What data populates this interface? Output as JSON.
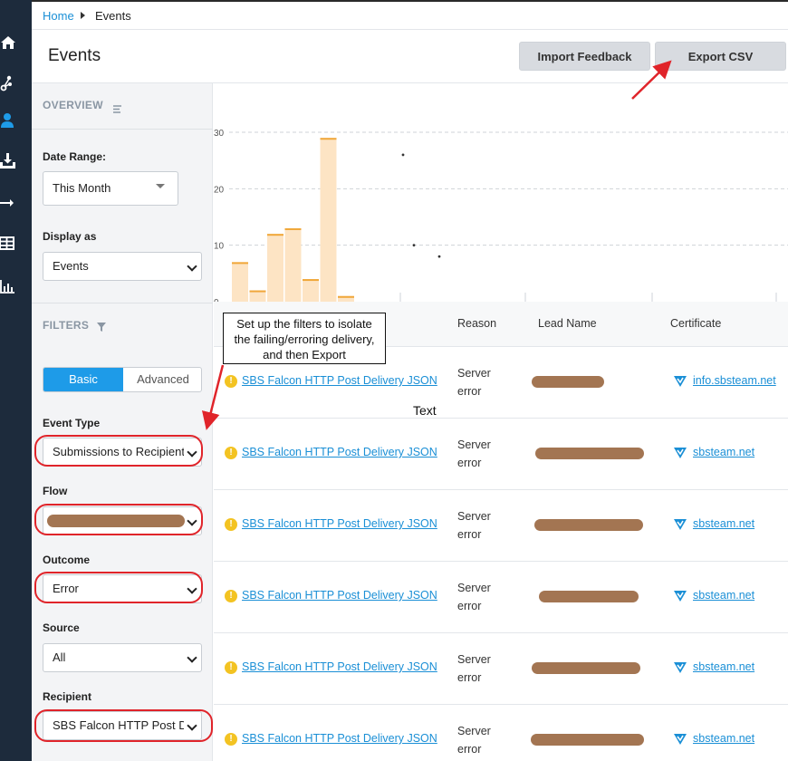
{
  "breadcrumb": {
    "home": "Home",
    "current": "Events"
  },
  "header": {
    "title": "Events",
    "import_label": "Import Feedback",
    "export_label": "Export CSV"
  },
  "nav_icons": [
    "home-icon",
    "flow-icon",
    "user-icon",
    "download-icon",
    "arrow-right-icon",
    "table-icon",
    "bar-chart-icon"
  ],
  "sidebar": {
    "overview_title": "OVERVIEW",
    "date_range_label": "Date Range:",
    "date_range_value": "This Month",
    "display_as_label": "Display as",
    "display_as_value": "Events",
    "filters_title": "FILTERS",
    "tab_basic": "Basic",
    "tab_advanced": "Advanced",
    "event_type_label": "Event Type",
    "event_type_value": "Submissions to Recipient",
    "flow_label": "Flow",
    "outcome_label": "Outcome",
    "outcome_value": "Error",
    "source_label": "Source",
    "source_value": "All",
    "recipient_label": "Recipient",
    "recipient_value": "SBS Falcon HTTP Post Delivery JSON"
  },
  "chart_data": {
    "type": "bar",
    "ylim": [
      0,
      30
    ],
    "yticks": [
      "0",
      "10",
      "20",
      "30"
    ],
    "values": [
      7,
      2,
      12,
      13,
      4,
      29,
      1
    ],
    "scatter": [
      26,
      10,
      8
    ],
    "grid": true,
    "colors": {
      "bar_fill": "#fde4c4",
      "bar_top": "#f0a73a"
    }
  },
  "table": {
    "columns": {
      "reason": "Reason",
      "lead_name": "Lead Name",
      "certificate": "Certificate"
    },
    "rows": [
      {
        "recipient": "SBS Falcon HTTP Post Delivery JSON",
        "reason": "Server error",
        "certificate": "info.sbsteam.net"
      },
      {
        "recipient": "SBS Falcon HTTP Post Delivery JSON",
        "reason": "Server error",
        "certificate": "sbsteam.net"
      },
      {
        "recipient": "SBS Falcon HTTP Post Delivery JSON",
        "reason": "Server error",
        "certificate": "sbsteam.net"
      },
      {
        "recipient": "SBS Falcon HTTP Post Delivery JSON",
        "reason": "Server error",
        "certificate": "sbsteam.net"
      },
      {
        "recipient": "SBS Falcon HTTP Post Delivery JSON",
        "reason": "Server error",
        "certificate": "sbsteam.net"
      },
      {
        "recipient": "SBS Falcon HTTP Post Delivery JSON",
        "reason": "Server error",
        "certificate": "sbsteam.net"
      }
    ]
  },
  "annotation": {
    "callout_line1": "Set up the filters to isolate",
    "callout_line2": "the failing/erroring delivery,",
    "callout_line3": "and then Export",
    "stray_text": "Text"
  }
}
